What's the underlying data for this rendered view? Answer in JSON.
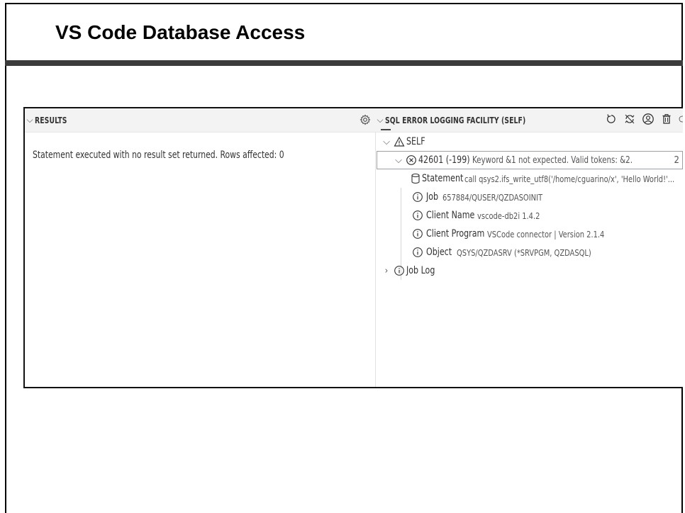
{
  "slide": {
    "title": "VS Code Database Access"
  },
  "results_panel": {
    "header": "RESULTS",
    "message": "Statement executed with no result set returned. Rows affected: 0"
  },
  "error_panel": {
    "header": "SQL ERROR LOGGING FACILITY (SELF)",
    "root": "SELF",
    "error_code": "42601 (-199)",
    "error_message": "Keyword &1 not expected. Valid tokens: &2.",
    "error_count_truncated": "2",
    "details": [
      {
        "label": "Statement",
        "value": "call qsys2.ifs_write_utf8('/home/cguarino/x', 'Hello World!'..."
      },
      {
        "label": "Job",
        "value": "657884/QUSER/QZDASOINIT"
      },
      {
        "label": "Client Name",
        "value": "vscode-db2i 1.4.2"
      },
      {
        "label": "Client Program",
        "value": "VSCode connector | Version 2.1.4"
      },
      {
        "label": "Object",
        "value": "QSYS/QZDASRV (*SRVPGM, QZDASQL)"
      }
    ],
    "job_log": "Job Log"
  },
  "icons": [
    "chevron-down-icon",
    "gear-icon",
    "refresh-icon",
    "sync-icon",
    "account-icon",
    "trash-icon",
    "warning-icon",
    "error-icon",
    "database-icon",
    "info-icon",
    "chevron-right-icon"
  ]
}
